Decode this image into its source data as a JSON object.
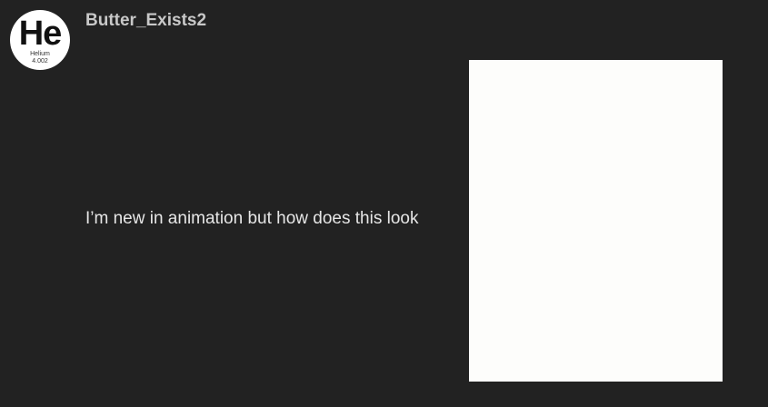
{
  "post": {
    "username": "Butter_Exists2",
    "avatar": {
      "symbol": "He",
      "element_name": "Helium",
      "atomic_mass": "4.002"
    },
    "text": "I’m new in animation but how does this look",
    "attachment_color": "#fdfdfb"
  },
  "colors": {
    "background": "#222222",
    "username": "#c8c8c8",
    "text": "#e6e6e6"
  }
}
